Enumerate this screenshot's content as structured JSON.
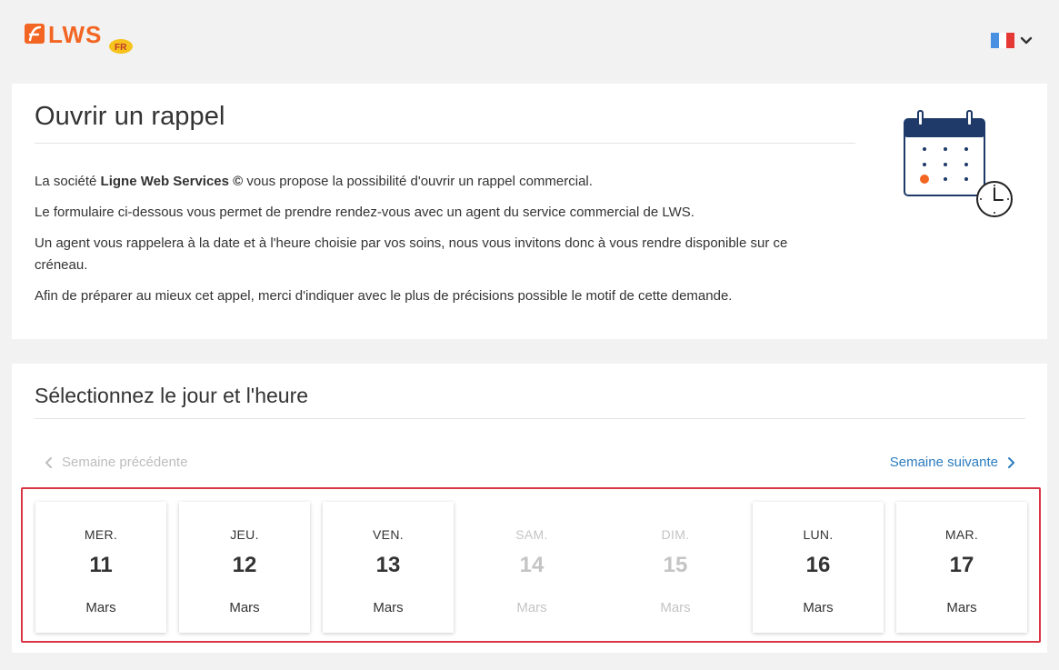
{
  "header": {
    "logo_text": "LWS",
    "logo_badge": "FR",
    "language_flag": "french-flag-icon",
    "flag_colors": [
      "#4a90e2",
      "#ffffff",
      "#e53935"
    ]
  },
  "intro": {
    "title": "Ouvrir un rappel",
    "p1_prefix": "La société ",
    "p1_bold": "Ligne Web Services ©",
    "p1_suffix": " vous propose la possibilité d'ouvrir un rappel commercial.",
    "p2": "Le formulaire ci-dessous vous permet de prendre rendez-vous avec un agent du service commercial de LWS.",
    "p3": "Un agent vous rappelera à la date et à l'heure choisie par vos soins, nous vous invitons donc à vous rendre disponible sur ce créneau.",
    "p4": "Afin de préparer au mieux cet appel, merci d'indiquer avec le plus de précisions possible le motif de cette demande.",
    "illustration": "calendar-clock-icon"
  },
  "schedule": {
    "title": "Sélectionnez le jour et l'heure",
    "prev_week": "Semaine précédente",
    "next_week": "Semaine suivante",
    "days": [
      {
        "dow": "MER.",
        "num": "11",
        "month": "Mars",
        "enabled": true
      },
      {
        "dow": "JEU.",
        "num": "12",
        "month": "Mars",
        "enabled": true
      },
      {
        "dow": "VEN.",
        "num": "13",
        "month": "Mars",
        "enabled": true
      },
      {
        "dow": "SAM.",
        "num": "14",
        "month": "Mars",
        "enabled": false
      },
      {
        "dow": "DIM.",
        "num": "15",
        "month": "Mars",
        "enabled": false
      },
      {
        "dow": "LUN.",
        "num": "16",
        "month": "Mars",
        "enabled": true
      },
      {
        "dow": "MAR.",
        "num": "17",
        "month": "Mars",
        "enabled": true
      }
    ]
  },
  "colors": {
    "accent_link": "#2b7cc0",
    "highlight_border": "#d93645",
    "logo_orange": "#f26522",
    "calendar_navy": "#1f3a68"
  }
}
